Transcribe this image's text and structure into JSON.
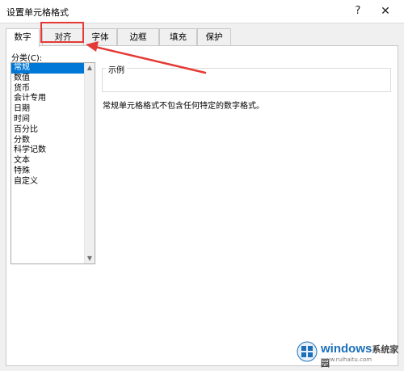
{
  "window": {
    "title": "设置单元格格式",
    "help": "?",
    "close": "✕"
  },
  "tabs": [
    "数字",
    "对齐",
    "字体",
    "边框",
    "填充",
    "保护"
  ],
  "category": {
    "label": "分类(C):",
    "items": [
      "常规",
      "数值",
      "货币",
      "会计专用",
      "日期",
      "时间",
      "百分比",
      "分数",
      "科学记数",
      "文本",
      "特殊",
      "自定义"
    ],
    "selected": "常规"
  },
  "sample": {
    "legend": "示例"
  },
  "description": "常规单元格格式不包含任何特定的数字格式。",
  "annotation": {
    "color": "#e53935"
  },
  "watermark": {
    "brand": "windows",
    "suffix": "系统家园",
    "url": "www.ruihaitu.com"
  }
}
